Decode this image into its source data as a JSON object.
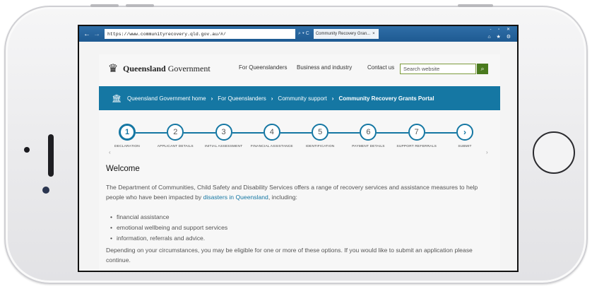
{
  "browser": {
    "address": "https://www.communityrecovery.qld.gov.au/#/",
    "address_tools": "⌕ ▾ C",
    "tab_title": "Community Recovery Gran...",
    "window_controls": "- ▫ ✕",
    "tool_icons": "⌂ ★ ⚙"
  },
  "header": {
    "logo_bold": "Queensland",
    "logo_rest": " Government",
    "links": [
      "For Queenslanders",
      "Business and industry",
      "Contact us"
    ],
    "search_placeholder": "Search website"
  },
  "breadcrumb": {
    "items": [
      "Queensland Government home",
      "For Queenslanders",
      "Community support"
    ],
    "current": "Community Recovery Grants Portal"
  },
  "steps": [
    {
      "num": "1",
      "label": "DECLARATION"
    },
    {
      "num": "2",
      "label": "APPLICANT DETAILS"
    },
    {
      "num": "3",
      "label": "INITIAL ASSESSMENT"
    },
    {
      "num": "4",
      "label": "FINANCIAL ASSISTANCE"
    },
    {
      "num": "5",
      "label": "IDENTIFICATION"
    },
    {
      "num": "6",
      "label": "PAYMENT DETAILS"
    },
    {
      "num": "7",
      "label": "SUPPORT REFERRALS"
    },
    {
      "num": "›",
      "label": "SUBMIT"
    }
  ],
  "content": {
    "title": "Welcome",
    "intro_pre": "The Department of Communities, Child Safety and Disability Services offers a range of recovery services and assistance measures to help people who have been impacted by ",
    "intro_link": "disasters in Queensland",
    "intro_post": ", including:",
    "bullets": [
      "financial assistance",
      "emotional wellbeing and support services",
      "information, referrals and advice."
    ],
    "closing": "Depending on your circumstances, you may be eligible for one or more of these options. If you would like to submit an application please continue."
  }
}
